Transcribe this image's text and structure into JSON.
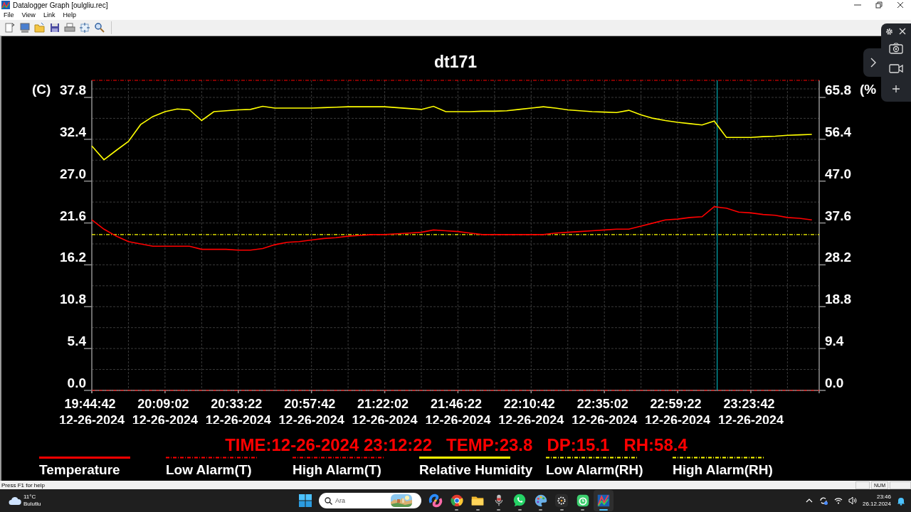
{
  "window": {
    "title": "Datalogger Graph [oulgliu.rec]"
  },
  "menu": [
    "File",
    "View",
    "Link",
    "Help"
  ],
  "toolbar": [
    {
      "kind": "new"
    },
    {
      "kind": "monitor"
    },
    {
      "kind": "open"
    },
    {
      "kind": "save"
    },
    {
      "kind": "print"
    },
    {
      "kind": "fit"
    },
    {
      "kind": "zoom"
    }
  ],
  "graph": {
    "chart_data": {
      "type": "line",
      "title": "dt171",
      "ylabel": "(C)",
      "y2label": "(%",
      "categories": [
        "19:44:42 12-26-2024",
        null,
        null,
        null,
        null,
        null,
        "20:09:02 12-26-2024",
        null,
        null,
        null,
        null,
        null,
        "20:33:22 12-26-2024",
        null,
        null,
        null,
        null,
        null,
        "20:57:42 12-26-2024",
        null,
        null,
        null,
        null,
        null,
        "21:22:02 12-26-2024",
        null,
        null,
        null,
        null,
        null,
        "21:46:22 12-26-2024",
        null,
        null,
        null,
        null,
        null,
        "22:10:42 12-26-2024",
        null,
        null,
        null,
        null,
        null,
        "22:35:02 12-26-2024",
        null,
        null,
        null,
        null,
        null,
        "22:59:22 12-26-2024",
        null,
        null,
        null,
        null,
        null,
        "23:23:42 12-26-2024",
        null,
        null,
        null,
        null,
        null
      ],
      "series": [
        {
          "name": "Temperature",
          "color": "#ff0000",
          "values": [
            22.0,
            20.8,
            19.9,
            19.2,
            18.9,
            18.6,
            18.6,
            18.6,
            18.6,
            18.2,
            18.2,
            18.2,
            18.1,
            18.1,
            18.3,
            18.8,
            19.1,
            19.2,
            19.4,
            19.6,
            19.7,
            19.9,
            20.0,
            20.1,
            20.1,
            20.2,
            20.3,
            20.4,
            20.7,
            20.6,
            20.5,
            20.3,
            20.1,
            20.1,
            20.1,
            20.1,
            20.1,
            20.1,
            20.3,
            20.4,
            20.5,
            20.6,
            20.7,
            20.8,
            20.8,
            21.2,
            21.6,
            22.0,
            22.1,
            22.3,
            22.4,
            23.7,
            23.5,
            23.0,
            22.9,
            22.7,
            22.6,
            22.3,
            22.2,
            22.0
          ]
        },
        {
          "name": "Relative Humidity",
          "color": "#ffff00",
          "axis": "y2",
          "values": [
            54.9,
            51.8,
            53.9,
            55.9,
            59.7,
            61.5,
            62.6,
            63.2,
            63.0,
            60.6,
            62.6,
            62.8,
            63.0,
            63.1,
            63.8,
            63.4,
            63.4,
            63.4,
            63.4,
            63.5,
            63.6,
            63.7,
            63.7,
            63.7,
            63.7,
            63.5,
            63.3,
            63.1,
            63.8,
            62.6,
            62.6,
            62.6,
            62.7,
            62.7,
            62.8,
            63.1,
            63.4,
            63.7,
            63.4,
            63.0,
            62.8,
            62.6,
            62.5,
            62.4,
            62.9,
            61.9,
            61.1,
            60.6,
            60.2,
            59.9,
            59.6,
            60.5,
            56.8,
            56.8,
            56.8,
            57.0,
            57.1,
            57.3,
            57.4,
            57.5
          ]
        }
      ],
      "grid": true,
      "ylim": [
        0,
        40
      ],
      "yticks": [
        {
          "value": 0,
          "label": "0.0"
        },
        {
          "value": 5.4,
          "label": "5.4"
        },
        {
          "value": 10.8,
          "label": "10.8"
        },
        {
          "value": 16.2,
          "label": "16.2"
        },
        {
          "value": 21.6,
          "label": "21.6"
        },
        {
          "value": 27,
          "label": "27.0"
        },
        {
          "value": 32.4,
          "label": "32.4"
        },
        {
          "value": 37.8,
          "label": "37.8"
        }
      ],
      "y2lim": [
        0,
        69.63
      ],
      "y2ticks": [
        {
          "value": 0,
          "label": "0.0"
        },
        {
          "value": 9.4,
          "label": "9.4"
        },
        {
          "value": 18.8,
          "label": "18.8"
        },
        {
          "value": 28.2,
          "label": "28.2"
        },
        {
          "value": 37.6,
          "label": "37.6"
        },
        {
          "value": 47,
          "label": "47.0"
        },
        {
          "value": 56.4,
          "label": "56.4"
        },
        {
          "value": 65.8,
          "label": "65.8"
        }
      ],
      "ref_lines": [
        {
          "label": "Low Alarm(T)",
          "axis": "y",
          "value": 0,
          "color": "#ff0000"
        },
        {
          "label": "High Alarm(T)",
          "axis": "y",
          "value": 40,
          "color": "#ff0000"
        },
        {
          "label": "Low Alarm(RH)",
          "axis": "y2",
          "value": 35,
          "color": "#ffff00"
        },
        {
          "label": "High Alarm(RH)",
          "axis": "y2",
          "color": "#ffff00"
        }
      ]
    },
    "readout": [
      "TIME:12-26-2024 23:12:22",
      "TEMP:23.8",
      "DP:15.1",
      "RH:58.4"
    ]
  },
  "status_bar": {
    "text": "Press F1 for help",
    "indicator": "NUM"
  },
  "taskbar": {
    "weather": {
      "temp": "11°C",
      "condition": "Bulutlu"
    },
    "search": {
      "placeholder": "Ara"
    },
    "apps": [
      {
        "kind": "swirl",
        "running": false,
        "active": false
      },
      {
        "kind": "browser",
        "running": true,
        "active": false
      },
      {
        "kind": "folder",
        "running": true,
        "active": false
      },
      {
        "kind": "mic",
        "running": true,
        "active": false
      },
      {
        "kind": "chat",
        "running": true,
        "active": false
      },
      {
        "kind": "palette",
        "running": true,
        "active": false
      },
      {
        "kind": "dots",
        "running": true,
        "active": false
      },
      {
        "kind": "timer",
        "running": true,
        "active": false
      },
      {
        "kind": "graph",
        "running": true,
        "active": true
      }
    ],
    "clock": {
      "time": "23:46",
      "date": "26.12.2024"
    }
  }
}
